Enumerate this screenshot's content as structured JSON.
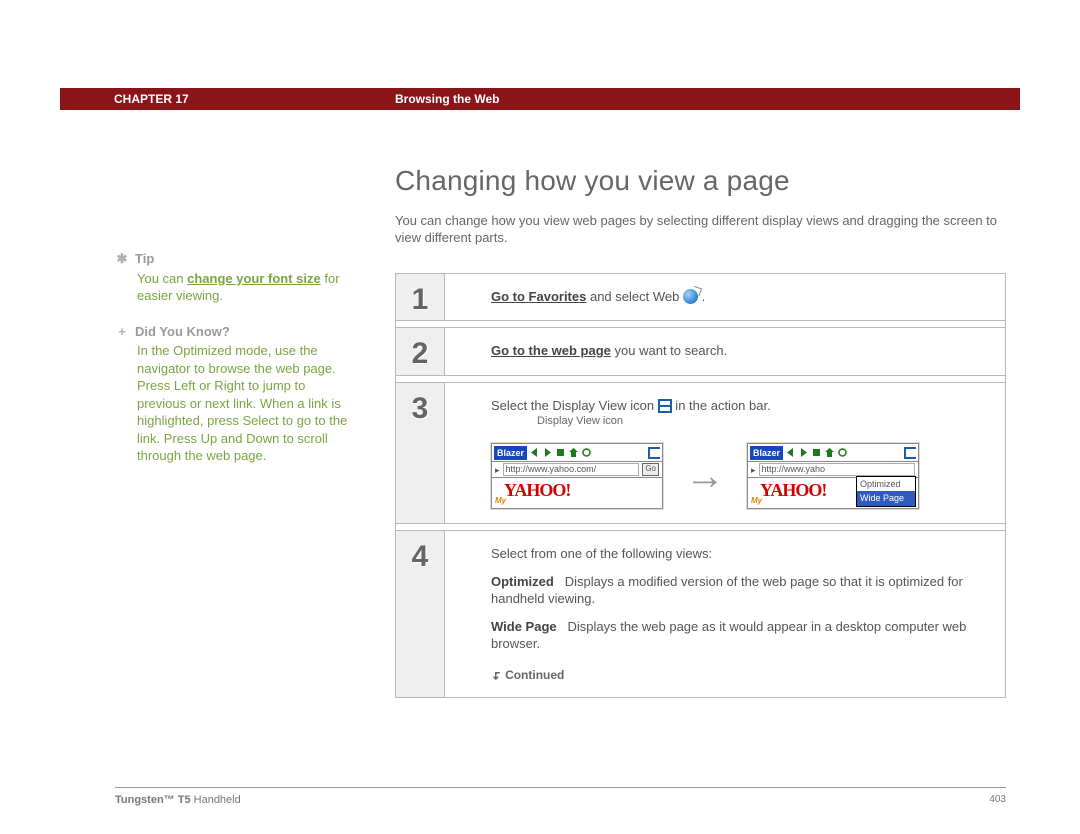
{
  "header": {
    "chapter": "CHAPTER 17",
    "section": "Browsing the Web"
  },
  "title": "Changing how you view a page",
  "intro": "You can change how you view web pages by selecting different display views and dragging the screen to view different parts.",
  "sidebar": {
    "tip_label": "Tip",
    "tip_text_a": "You can ",
    "tip_link": "change your font size",
    "tip_text_b": " for easier viewing.",
    "dyk_label": "Did You Know?",
    "dyk_text": "In the Optimized mode, use the navigator to browse the web page. Press Left or Right to jump to previous or next link. When a link is highlighted, press Select to go to the link. Press Up and Down to scroll through the web page."
  },
  "steps": {
    "s1": {
      "num": "1",
      "link": "Go to Favorites",
      "rest": " and select Web "
    },
    "s2": {
      "num": "2",
      "link": "Go to the web page",
      "rest": " you want to search."
    },
    "s3": {
      "num": "3",
      "pre": "Select the Display View icon ",
      "post": " in the action bar.",
      "caption": "Display View icon",
      "blazer": "Blazer",
      "url": "http://www.yahoo.com/",
      "url2": "http://www.yaho",
      "go": "Go",
      "brand": "YAHOO",
      "brand_ex": "!",
      "my": "My",
      "menu_opt": "Optimized",
      "menu_wide": "Wide Page"
    },
    "s4": {
      "num": "4",
      "lead": "Select from one of the following views:",
      "opt_h": "Optimized",
      "opt_t": "Displays a modified version of the web page so that it is optimized for handheld viewing.",
      "wide_h": "Wide Page",
      "wide_t": "Displays the web page as it would appear in a desktop computer web browser.",
      "cont": "Continued"
    }
  },
  "footer": {
    "product": "Tungsten™ T5",
    "kind": " Handheld",
    "page": "403"
  }
}
